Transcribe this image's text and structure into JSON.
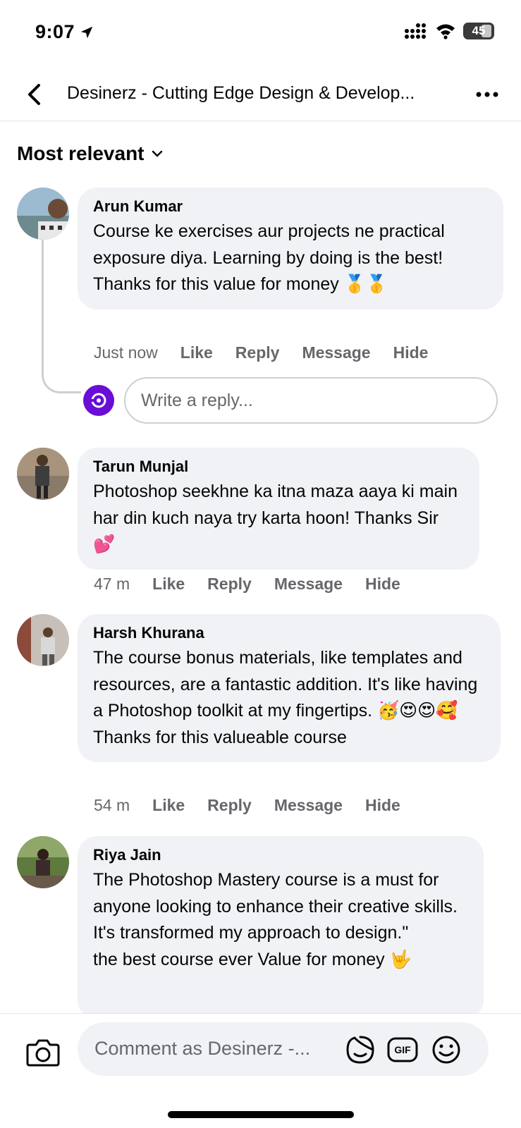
{
  "status_bar": {
    "time": "9:07",
    "battery": "45"
  },
  "header": {
    "title": "Desinerz - Cutting Edge Design & Develop..."
  },
  "sort": {
    "label": "Most relevant"
  },
  "comments": [
    {
      "author": "Arun Kumar",
      "text": "Course ke exercises aur projects ne practical exposure diya. Learning by doing is the best! Thanks for this value for money 🥇🥇",
      "time": "Just now",
      "like": "Like",
      "reply": "Reply",
      "message": "Message",
      "hide": "Hide"
    },
    {
      "author": "Tarun Munjal",
      "text": "Photoshop seekhne ka itna maza aaya ki main har din kuch naya try karta hoon! Thanks Sir 💕",
      "time": "47 m",
      "like": "Like",
      "reply": "Reply",
      "message": "Message",
      "hide": "Hide"
    },
    {
      "author": "Harsh Khurana",
      "text": "The course bonus materials, like templates and resources, are a fantastic addition. It's like having a Photoshop toolkit at my fingertips. 🥳😍😍🥰 Thanks for this valueable course",
      "time": "54 m",
      "like": "Like",
      "reply": "Reply",
      "message": "Message",
      "hide": "Hide"
    },
    {
      "author": "Riya Jain",
      "text": "The Photoshop Mastery course is a must for anyone looking to enhance their creative skills. It's transformed my approach to design.\"\nthe best course ever Value for money 🤟"
    }
  ],
  "reply_box": {
    "placeholder": "Write a reply..."
  },
  "composer": {
    "placeholder": "Comment as Desinerz -...",
    "gif_label": "GIF"
  },
  "colors": {
    "bubble": "#f0f2f5",
    "secondary_text": "#65676b",
    "page_avatar": "#6a0dd6"
  }
}
